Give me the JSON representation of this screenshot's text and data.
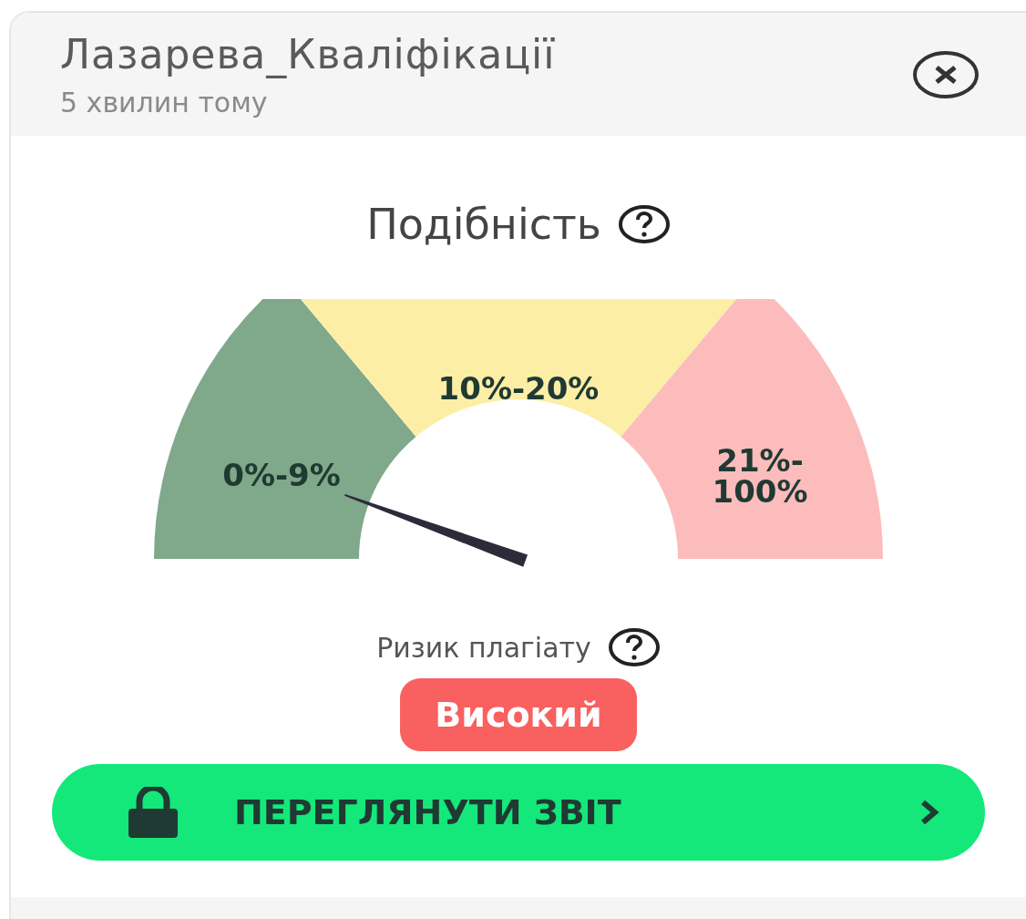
{
  "card": {
    "title": "Лазарева_Кваліфікації",
    "time": "5 хвилин тому"
  },
  "similarity": {
    "title": "Подібність",
    "segments": [
      {
        "lines": [
          "0%-9%"
        ],
        "color": "#80a88a"
      },
      {
        "lines": [
          "10%-20%"
        ],
        "color": "#fdeea6"
      },
      {
        "lines": [
          "21%-",
          "100%"
        ],
        "color": "#fdbcbc"
      }
    ]
  },
  "risk": {
    "label": "Ризик плагіату",
    "value": "Високий",
    "kind": "high"
  },
  "report_button": {
    "label": "ПЕРЕГЛЯНУТИ ЗВІТ",
    "locked": true
  }
}
